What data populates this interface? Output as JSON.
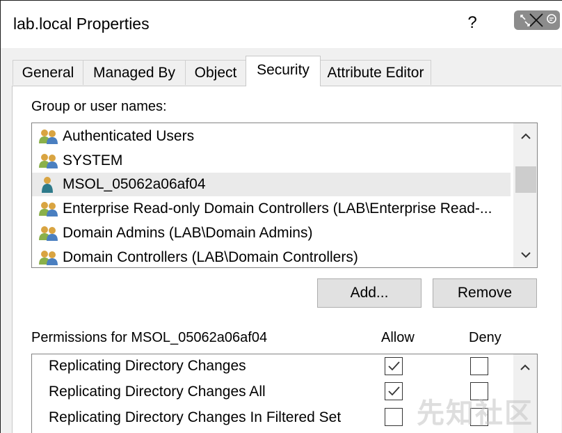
{
  "window": {
    "title": "lab.local Properties",
    "help_glyph": "?",
    "close_glyph": "×"
  },
  "tabs": [
    {
      "label": "General",
      "active": false
    },
    {
      "label": "Managed By",
      "active": false
    },
    {
      "label": "Object",
      "active": false
    },
    {
      "label": "Security",
      "active": true
    },
    {
      "label": "Attribute Editor",
      "active": false
    }
  ],
  "security": {
    "group_label": "Group or user names:",
    "principals": [
      {
        "name": "Authenticated Users",
        "icon": "group-users-icon",
        "selected": false
      },
      {
        "name": "SYSTEM",
        "icon": "group-users-icon",
        "selected": false
      },
      {
        "name": "MSOL_05062a06af04",
        "icon": "user-icon",
        "selected": true
      },
      {
        "name": "Enterprise Read-only Domain Controllers (LAB\\Enterprise Read-...",
        "icon": "group-users-icon",
        "selected": false
      },
      {
        "name": "Domain Admins (LAB\\Domain Admins)",
        "icon": "group-users-icon",
        "selected": false
      },
      {
        "name": "Domain Controllers (LAB\\Domain Controllers)",
        "icon": "group-users-icon",
        "selected": false
      }
    ],
    "add_label": "Add...",
    "remove_label": "Remove",
    "permissions_label": "Permissions for MSOL_05062a06af04",
    "allow_header": "Allow",
    "deny_header": "Deny",
    "permissions": [
      {
        "name": "Replicating Directory Changes",
        "allow": true,
        "deny": false
      },
      {
        "name": "Replicating Directory Changes All",
        "allow": true,
        "deny": false
      },
      {
        "name": "Replicating Directory Changes In Filtered Set",
        "allow": false,
        "deny": false
      }
    ]
  },
  "colors": {
    "selected_row": "#eaeaea",
    "panel_bg": "#f0f0f0",
    "button_bg": "#e1e1e1"
  },
  "watermark": "先知社区"
}
